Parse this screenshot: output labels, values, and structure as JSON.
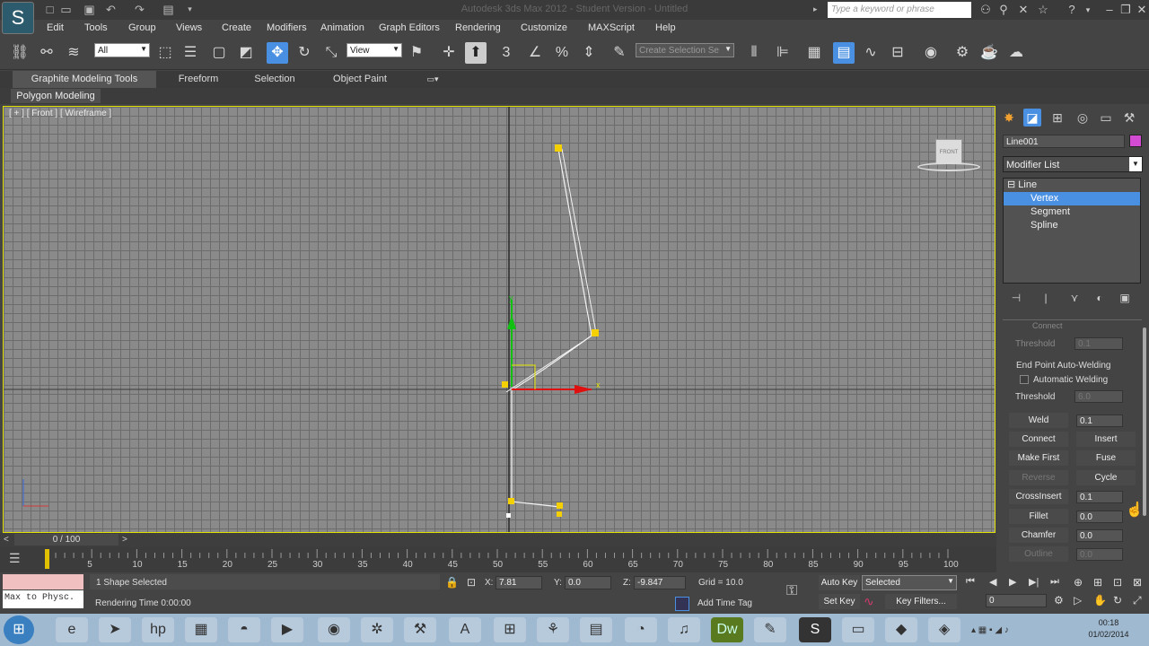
{
  "title": "Autodesk 3ds Max 2012 - Student Version - Untitled",
  "search_placeholder": "Type a keyword or phrase",
  "menu": [
    "Edit",
    "Tools",
    "Group",
    "Views",
    "Create",
    "Modifiers",
    "Animation",
    "Graph Editors",
    "Rendering",
    "Customize",
    "MAXScript",
    "Help"
  ],
  "toolbar": {
    "filter_value": "All",
    "refcoord_value": "View",
    "selection_set_placeholder": "Create Selection Se",
    "snap_angle_label": "3"
  },
  "ribbon": {
    "tabs": [
      "Graphite Modeling Tools",
      "Freeform",
      "Selection",
      "Object Paint"
    ],
    "sub_button": "Polygon Modeling"
  },
  "viewport": {
    "label": "[ + ] [ Front ] [ Wireframe ]",
    "viewcube_label": "FRONT",
    "axis_x": "x",
    "axis_y": "y"
  },
  "panel": {
    "object_name": "Line001",
    "object_color": "#d24bd2",
    "modifier_list": "Modifier List",
    "stack": [
      {
        "label": "Line",
        "selected": false
      },
      {
        "label": "Vertex",
        "selected": true
      },
      {
        "label": "Segment",
        "selected": false
      },
      {
        "label": "Spline",
        "selected": false
      }
    ],
    "rollout": {
      "connect_cb": "Connect",
      "threshold_1_label": "Threshold",
      "threshold_1_value": "0.1",
      "endpoint_group": "End Point Auto-Welding",
      "auto_weld_cb": "Automatic Welding",
      "threshold_2_label": "Threshold",
      "threshold_2_value": "6.0",
      "weld_label": "Weld",
      "weld_value": "0.1",
      "connect_btn": "Connect",
      "insert_btn": "Insert",
      "make_first_btn": "Make First",
      "fuse_btn": "Fuse",
      "reverse_btn": "Reverse",
      "cycle_btn": "Cycle",
      "crossinsert_btn": "CrossInsert",
      "crossinsert_value": "0.1",
      "fillet_btn": "Fillet",
      "fillet_value": "0.0",
      "chamfer_btn": "Chamfer",
      "chamfer_value": "0.0",
      "outline_btn": "Outline",
      "outline_value": "0.0"
    }
  },
  "timeline": {
    "frame_display": "0 / 100",
    "ticks": [
      "5",
      "10",
      "15",
      "20",
      "25",
      "30",
      "35",
      "40",
      "45",
      "50",
      "55",
      "60",
      "65",
      "70",
      "75",
      "80",
      "85",
      "90",
      "95",
      "100"
    ],
    "current_frame": 0,
    "total_frames": 100
  },
  "status": {
    "maxscript_text": "Max to Physc.",
    "selection": "1 Shape Selected",
    "rendering_time": "Rendering Time  0:00:00",
    "x_label": "X:",
    "x_value": "7.81",
    "y_label": "Y:",
    "y_value": "0.0",
    "z_label": "Z:",
    "z_value": "-9.847",
    "grid": "Grid = 10.0",
    "add_time_tag": "Add Time Tag",
    "auto_key": "Auto Key",
    "set_key": "Set Key",
    "selected_dd": "Selected",
    "key_filters": "Key Filters...",
    "frame_field": "0"
  },
  "taskbar": {
    "time": "00:18",
    "date": "01/02/2014"
  }
}
